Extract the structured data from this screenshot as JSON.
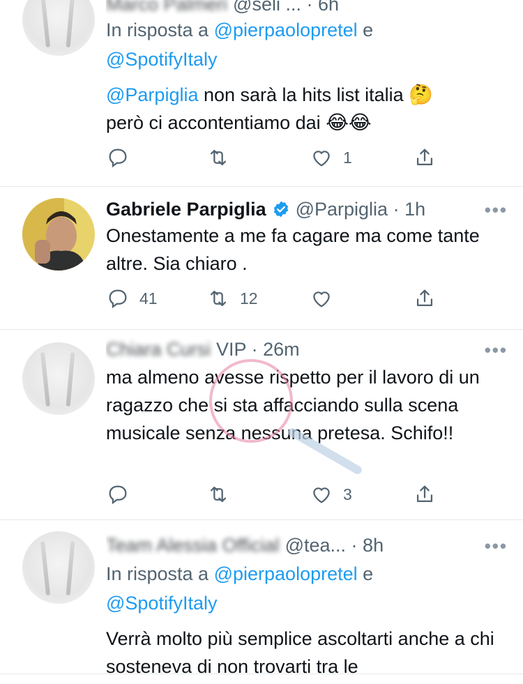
{
  "tweets": [
    {
      "handle_partial": "@seli ... · 6h",
      "reply_prefix": "In risposta a",
      "reply_user1": "@pierpaolopretel",
      "reply_and": "e",
      "reply_user2": "@SpotifyItaly",
      "mention": "@Parpiglia",
      "text_line1_rest": "non sarà la hits list italia",
      "emoji1": "🤔",
      "text_line2": "però ci accontentiamo dai",
      "emoji2": "😂😂",
      "like_count": "1"
    },
    {
      "name": "Gabriele Parpiglia",
      "handle": "@Parpiglia · 1h",
      "text": "Onestamente a me fa cagare ma come tante altre. Sia chiaro .",
      "reply_count": "41",
      "retweet_count": "12",
      "more": "•••"
    },
    {
      "handle": "VIP · 26m",
      "text": "ma almeno avesse rispetto per il lavoro di un ragazzo che si sta affacciando sulla scena musicale senza nessuna pretesa. Schifo!!",
      "like_count": "3",
      "more": "•••"
    },
    {
      "handle": "@tea... · 8h",
      "reply_prefix": "In risposta a",
      "reply_user1": "@pierpaolopretel",
      "reply_and": "e",
      "reply_user2": "@SpotifyItaly",
      "text": "Verrà molto più semplice ascoltarti anche a chi sosteneva di non trovarti tra le",
      "more": "•••"
    }
  ],
  "colors": {
    "accent": "#1d9bf0",
    "secondary_text": "#536471"
  },
  "icons": [
    "reply-icon",
    "retweet-icon",
    "like-icon",
    "share-icon",
    "verified-badge-icon",
    "more-icon"
  ]
}
